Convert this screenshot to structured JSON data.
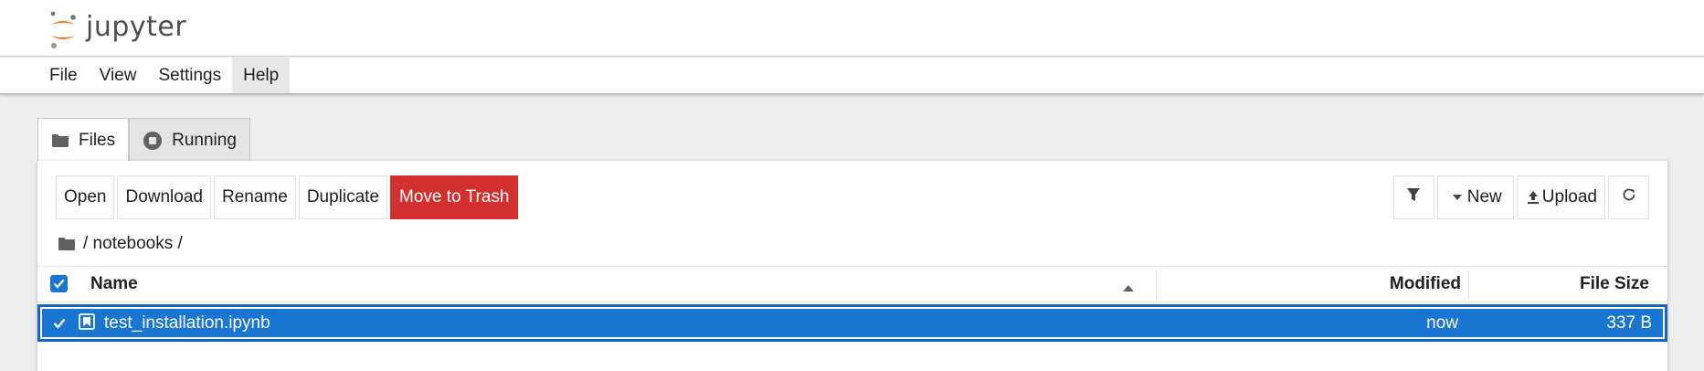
{
  "app": {
    "logo_text": "jupyter",
    "brand_orange": "#f37726",
    "accent": "#1976d2",
    "danger": "#d32f2f"
  },
  "menu": [
    "File",
    "View",
    "Settings",
    "Help"
  ],
  "tabs": [
    {
      "label": "Files",
      "icon": "folder-icon",
      "active": true
    },
    {
      "label": "Running",
      "icon": "stop-circle-icon",
      "active": false
    }
  ],
  "toolbar": {
    "open": "Open",
    "download": "Download",
    "rename": "Rename",
    "duplicate": "Duplicate",
    "move_to_trash": "Move to Trash",
    "new": "New",
    "upload": "Upload"
  },
  "breadcrumb": {
    "path": "/ notebooks /"
  },
  "columns": {
    "name": "Name",
    "modified": "Modified",
    "size": "File Size"
  },
  "files": [
    {
      "name": "test_installation.ipynb",
      "modified": "now",
      "size": "337 B",
      "selected": true,
      "icon": "notebook-icon"
    }
  ]
}
